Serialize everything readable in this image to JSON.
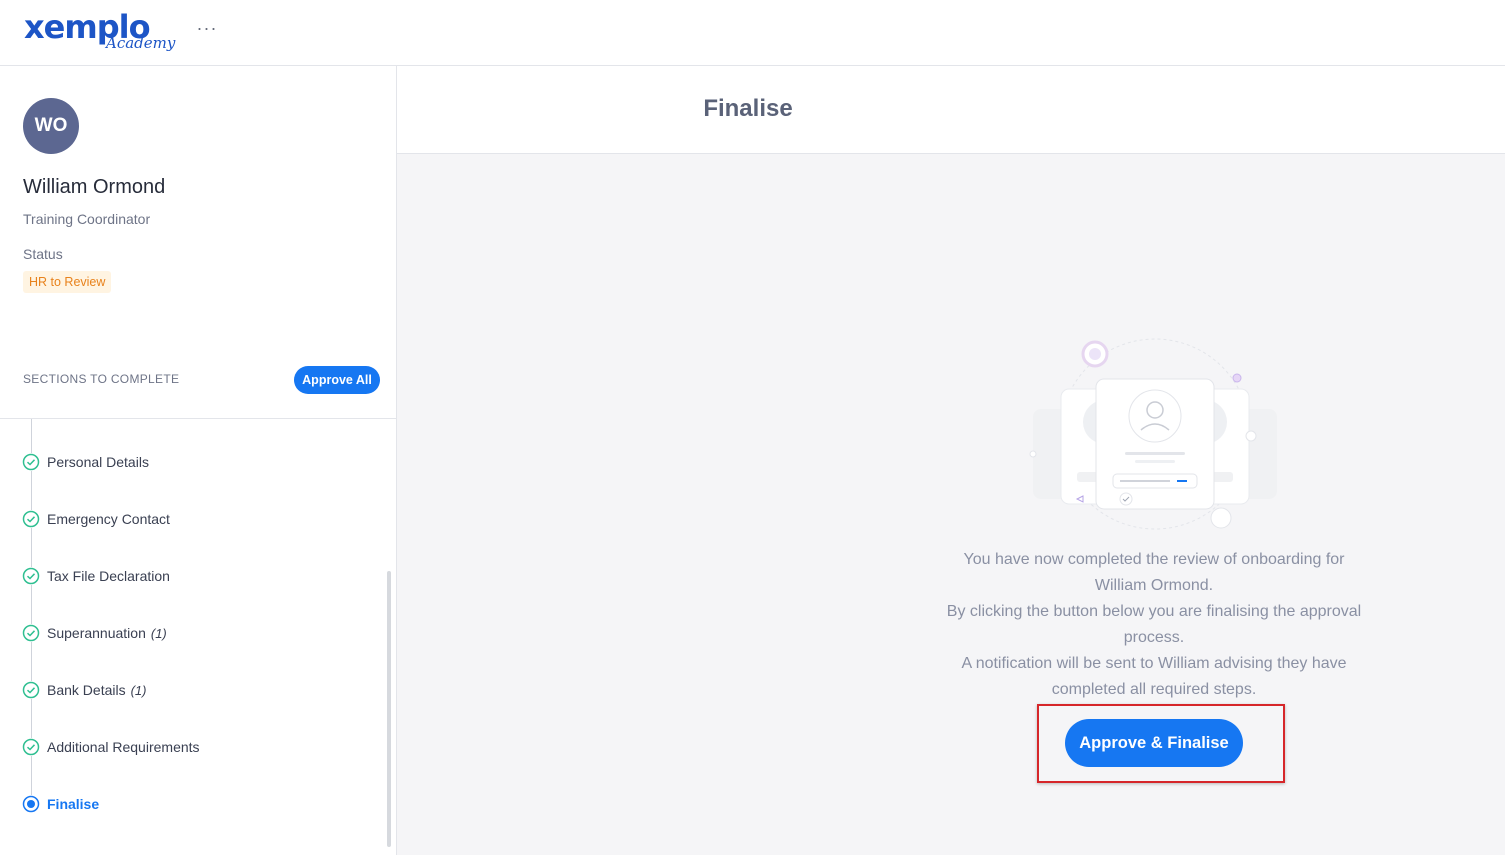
{
  "brand": {
    "logo_main": "xemplo",
    "logo_sub": "Academy",
    "more": "···"
  },
  "colors": {
    "accent": "#1677f2",
    "avatar": "#5c6791",
    "status_text": "#e8821c",
    "status_bg": "#fff4e2",
    "success": "#2fbf91",
    "highlight": "#d6262a"
  },
  "user": {
    "initials": "WO",
    "name": "William Ormond",
    "role": "Training Coordinator",
    "status_label": "Status",
    "status": "HR to Review"
  },
  "sections": {
    "label": "SECTIONS TO COMPLETE",
    "approve_all": "Approve All",
    "items": [
      {
        "label": "Personal Details",
        "count": "",
        "state": "complete"
      },
      {
        "label": "Emergency Contact",
        "count": "",
        "state": "complete"
      },
      {
        "label": "Tax File Declaration",
        "count": "",
        "state": "complete"
      },
      {
        "label": "Superannuation",
        "count": "(1)",
        "state": "complete"
      },
      {
        "label": "Bank Details",
        "count": "(1)",
        "state": "complete"
      },
      {
        "label": "Additional Requirements",
        "count": "",
        "state": "complete"
      },
      {
        "label": "Finalise",
        "count": "",
        "state": "active"
      }
    ]
  },
  "main": {
    "title": "Finalise",
    "message_lines": [
      "You have now completed the review of onboarding for",
      "William Ormond.",
      "By clicking the button below you are finalising the approval",
      "process.",
      "A notification will be sent to William advising they have",
      "completed all required steps."
    ],
    "button": "Approve & Finalise"
  }
}
